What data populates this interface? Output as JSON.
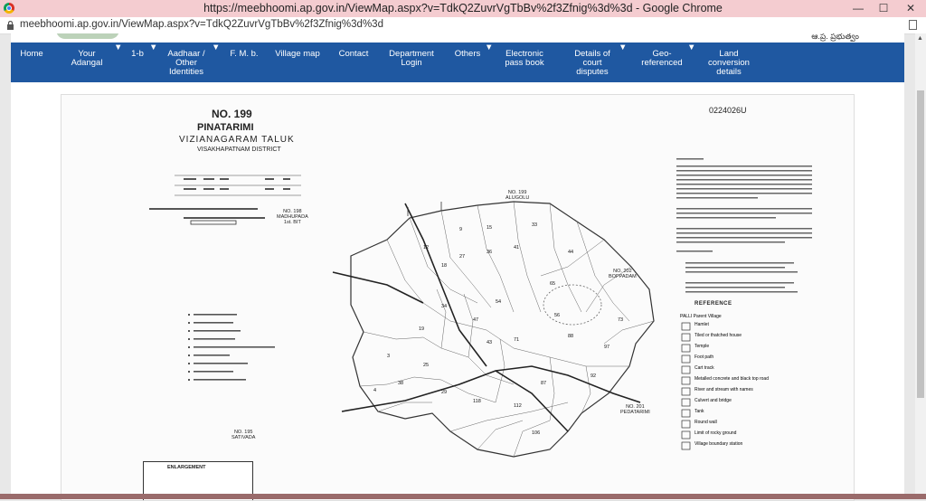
{
  "window": {
    "title": "https://meebhoomi.ap.gov.in/ViewMap.aspx?v=TdkQ2ZuvrVgTbBv%2f3Zfnig%3d%3d - Google Chrome",
    "controls": [
      "—",
      "☐",
      "✕"
    ]
  },
  "address_bar": {
    "url": "meebhoomi.ap.gov.in/ViewMap.aspx?v=TdkQ2ZuvrVgTbBv%2f3Zfnig%3d%3d"
  },
  "nav": {
    "items": [
      {
        "label": "Home",
        "dropdown": false
      },
      {
        "label": "Your\nAdangal",
        "dropdown": true
      },
      {
        "label": "1-b",
        "dropdown": true
      },
      {
        "label": "Aadhaar /\nOther\nIdentities",
        "dropdown": true
      },
      {
        "label": "F. M. b.",
        "dropdown": false
      },
      {
        "label": "Village map",
        "dropdown": false
      },
      {
        "label": "Contact",
        "dropdown": false
      },
      {
        "label": "Department\nLogin",
        "dropdown": false
      },
      {
        "label": "Others",
        "dropdown": true
      },
      {
        "label": "Electronic\npass book",
        "dropdown": false
      },
      {
        "label": "Details of\ncourt\ndisputes",
        "dropdown": true
      },
      {
        "label": "Geo-\nreferenced",
        "dropdown": true
      },
      {
        "label": "Land\nconversion\ndetails",
        "dropdown": false
      }
    ]
  },
  "map": {
    "number": "NO. 199",
    "village": "PINATARIMI",
    "taluk": "VIZIANAGARAM TALUK",
    "district": "VISAKHAPATNAM DISTRICT",
    "code": "0224026U",
    "adjacent": {
      "north": "NO. 199\nALUGOLU",
      "northwest": "NO. 198\nMADHUPADA\n1st. BIT",
      "east": "NO. 202\nBOPPADAM",
      "southeast": "NO. 201\nPEDATARIMI",
      "southwest": "NO. 195\nSATIVADA"
    },
    "enlargement": "ENLARGEMENT",
    "reference_title": "REFERENCE",
    "reference_items": [
      "PALLI  Parent Village",
      "Hamlet",
      "Tiled or thatched house",
      "Temple",
      "Foot path",
      "Cart track",
      "Metalled concrete and black top road",
      "River and stream with names",
      "Culvert and bridge",
      "Tank",
      "Round wall",
      "Limit of rocky ground",
      "Village boundary station"
    ]
  },
  "colors": {
    "nav_bg": "#1f58a1",
    "titlebar_bg": "#f4ccd0"
  }
}
